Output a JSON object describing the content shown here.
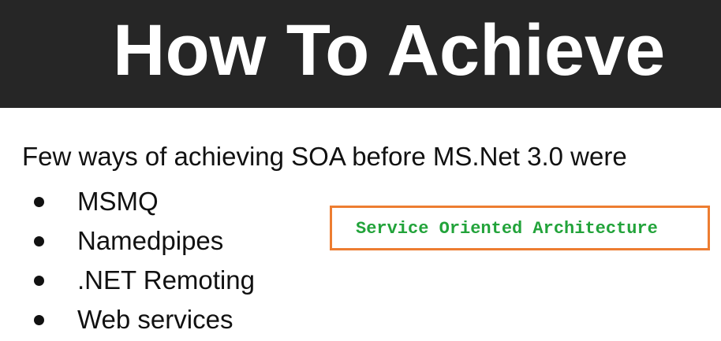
{
  "slide": {
    "title": "How To Achieve",
    "intro": "Few ways of achieving SOA before MS.Net 3.0 were",
    "bullets": [
      "MSMQ",
      "Namedpipes",
      ".NET Remoting",
      "Web services"
    ]
  },
  "annotation": {
    "text": "Service Oriented Architecture",
    "text_color": "#22a33a",
    "border_color": "#ed7d31"
  },
  "colors": {
    "header_background": "#262626",
    "header_text": "#ffffff",
    "body_text": "#111111"
  }
}
